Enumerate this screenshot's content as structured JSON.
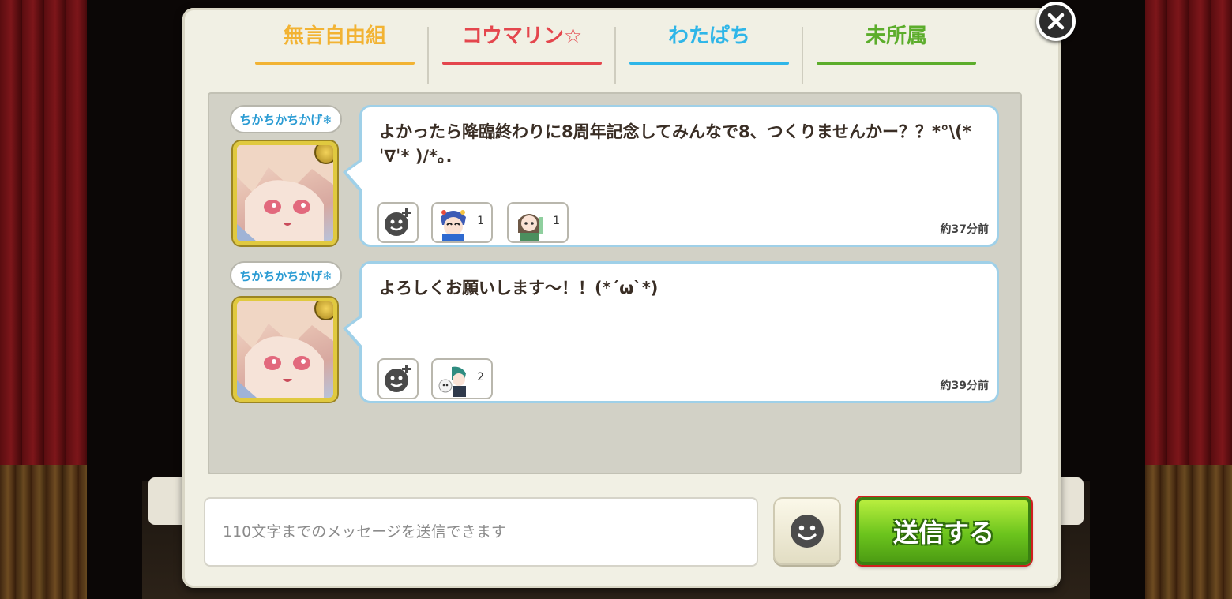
{
  "tabs": [
    {
      "label": "無言自由組",
      "color": "#f2b333"
    },
    {
      "label": "コウマリン☆",
      "color": "#e4464d"
    },
    {
      "label": "わたぱち",
      "color": "#2fb6e8"
    },
    {
      "label": "未所属",
      "color": "#5cad2b"
    }
  ],
  "messages": [
    {
      "sender": "ちかちかちかげ❄",
      "text": "よかったら降臨終わりに8周年記念してみんなで8、つくりませんかー？？*°\\(*ˈ∇ˈ* )/*｡.",
      "reactions": [
        {
          "stamp": "stamp-character-a",
          "count": "1"
        },
        {
          "stamp": "stamp-character-b",
          "count": "1"
        }
      ],
      "time": "約37分前"
    },
    {
      "sender": "ちかちかちかげ❄",
      "text": "よろしくお願いします～！！(*´ω`*)",
      "reactions": [
        {
          "stamp": "stamp-character-c",
          "count": "2"
        }
      ],
      "time": "約39分前"
    }
  ],
  "composer": {
    "placeholder": "110文字までのメッセージを送信できます",
    "send_label": "送信する"
  },
  "icons": {
    "close": "close-icon",
    "add_reaction": "add-reaction-icon",
    "stamp": "stamp-face-icon"
  }
}
